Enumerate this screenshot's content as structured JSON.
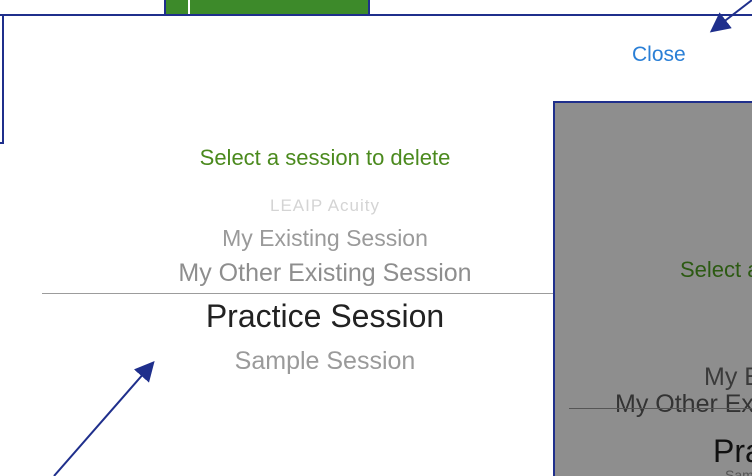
{
  "dialog": {
    "close_label": "Close",
    "prompt": "Select a session to delete",
    "picker_options": [
      "LEAIP Acuity",
      "My Existing Session",
      "My Other Existing Session",
      "Practice Session",
      "Sample Session"
    ],
    "selected_option": "Practice Session"
  },
  "overlay_preview": {
    "prompt": "Select a session to delete",
    "options": [
      "My Existing Session",
      "My Other Existing Session",
      "Practice Session",
      "Sample Session"
    ]
  },
  "colors": {
    "prompt_green": "#4b8a1e",
    "link_blue": "#2a7fd6",
    "annotation_navy": "#1f2f8c",
    "overlay_gray": "#8e8e8e"
  }
}
